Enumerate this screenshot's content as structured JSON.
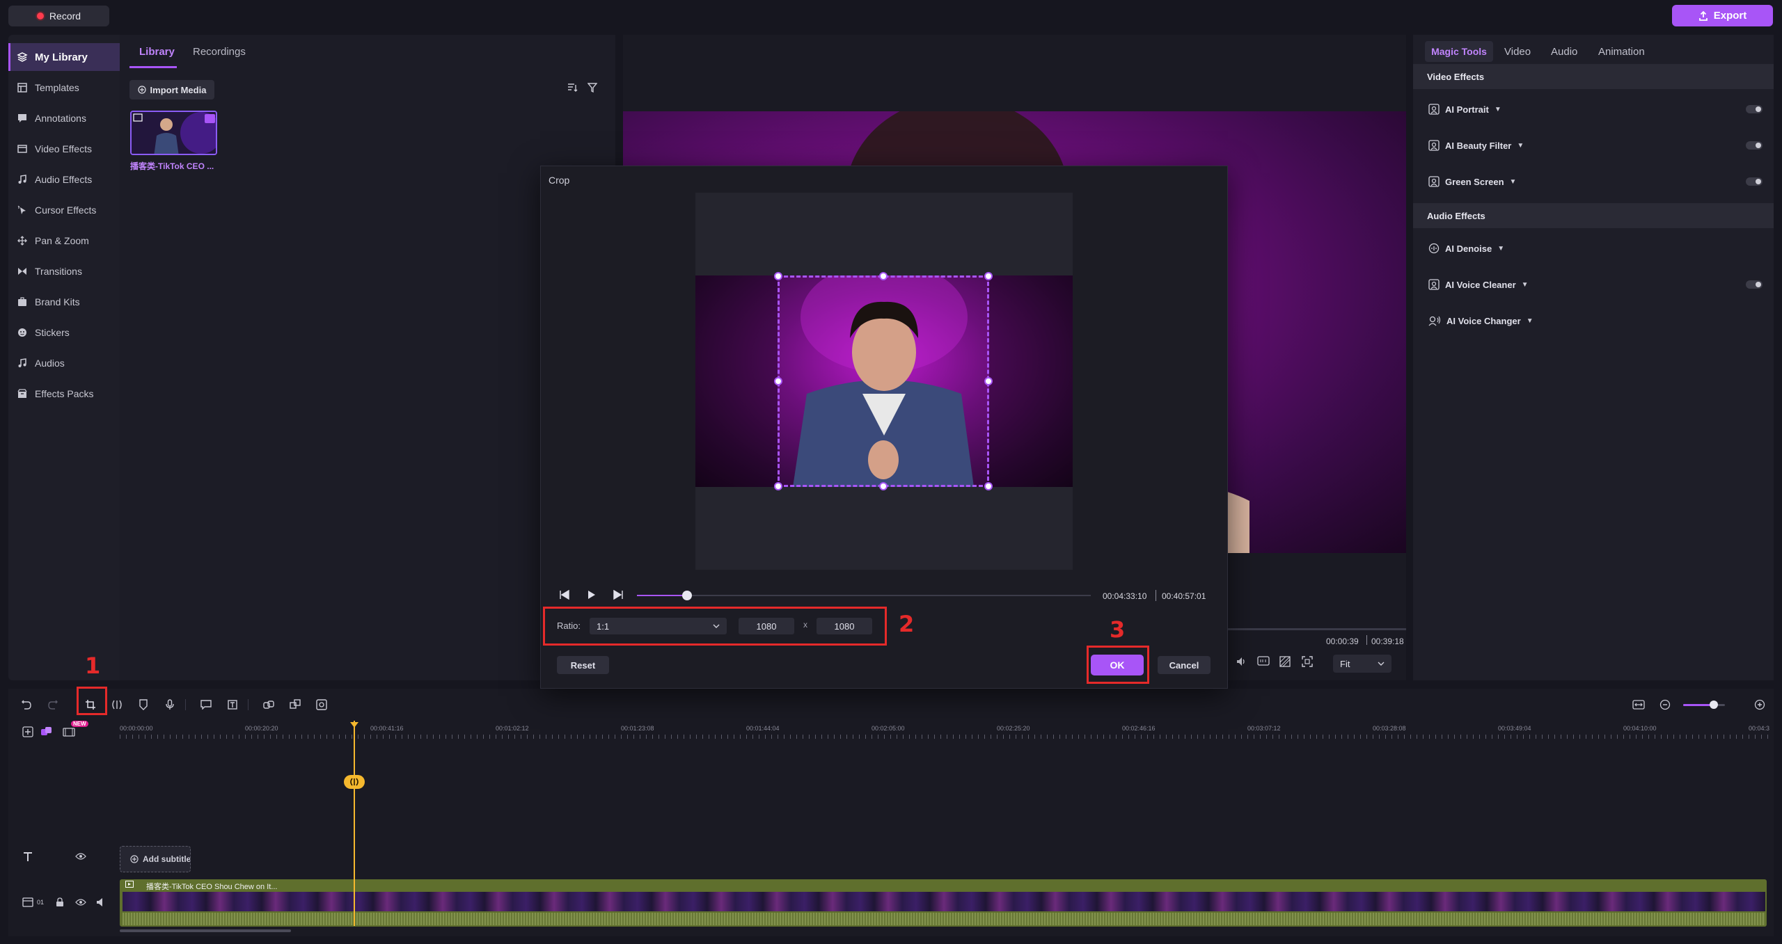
{
  "topbar": {
    "record_label": "Record",
    "export_label": "Export"
  },
  "sidebar": {
    "items": [
      {
        "label": "My Library",
        "icon": "layers-icon"
      },
      {
        "label": "Templates",
        "icon": "template-icon"
      },
      {
        "label": "Annotations",
        "icon": "annotation-icon"
      },
      {
        "label": "Video Effects",
        "icon": "video-effects-icon"
      },
      {
        "label": "Audio Effects",
        "icon": "music-note-icon"
      },
      {
        "label": "Cursor Effects",
        "icon": "cursor-icon"
      },
      {
        "label": "Pan & Zoom",
        "icon": "pan-zoom-icon"
      },
      {
        "label": "Transitions",
        "icon": "transition-icon"
      },
      {
        "label": "Brand Kits",
        "icon": "brand-kit-icon"
      },
      {
        "label": "Stickers",
        "icon": "sticker-icon"
      },
      {
        "label": "Audios",
        "icon": "audio-icon"
      },
      {
        "label": "Effects Packs",
        "icon": "package-icon"
      }
    ]
  },
  "library": {
    "tabs": [
      "Library",
      "Recordings"
    ],
    "import_label": "Import Media",
    "media": [
      {
        "label": "播客类-TikTok CEO ..."
      }
    ]
  },
  "preview": {
    "time_current": "00:00:39",
    "time_total": "00:39:18",
    "fit_label": "Fit"
  },
  "right_panel": {
    "tabs": [
      "Magic Tools",
      "Video",
      "Audio",
      "Animation"
    ],
    "video_effects_title": "Video Effects",
    "video_effects": [
      {
        "label": "AI Portrait",
        "has_toggle": true
      },
      {
        "label": "AI Beauty Filter",
        "has_toggle": true
      },
      {
        "label": "Green Screen",
        "has_toggle": true
      }
    ],
    "audio_effects_title": "Audio Effects",
    "audio_effects": [
      {
        "label": "AI Denoise",
        "has_toggle": false
      },
      {
        "label": "AI Voice Cleaner",
        "has_toggle": true
      },
      {
        "label": "AI Voice Changer",
        "has_toggle": false
      }
    ]
  },
  "crop_dialog": {
    "title": "Crop",
    "time_current": "00:04:33:10",
    "time_total": "00:40:57:01",
    "progress": 0.11,
    "ratio_label": "Ratio:",
    "ratio_value": "1:1",
    "width_value": "1080",
    "x_label": "x",
    "height_value": "1080",
    "reset_label": "Reset",
    "ok_label": "OK",
    "cancel_label": "Cancel"
  },
  "timeline": {
    "new_badge": "NEW",
    "ruler_labels": [
      "00:00:00:00",
      "00:00:20:20",
      "00:00:41:16",
      "00:01:02:12",
      "00:01:23:08",
      "00:01:44:04",
      "00:02:05:00",
      "00:02:25:20",
      "00:02:46:16",
      "00:03:07:12",
      "00:03:28:08",
      "00:03:49:04",
      "00:04:10:00",
      "00:04:3"
    ],
    "add_subtitle_label": "Add subtitle",
    "track_number": "01",
    "video_clip_title": "播客类-TikTok CEO Shou Chew on It..."
  },
  "annotations": [
    "1",
    "2",
    "3"
  ],
  "colors": {
    "accent": "#a855f7",
    "annotation_red": "#e52a2a",
    "playhead": "#f5b82e"
  }
}
